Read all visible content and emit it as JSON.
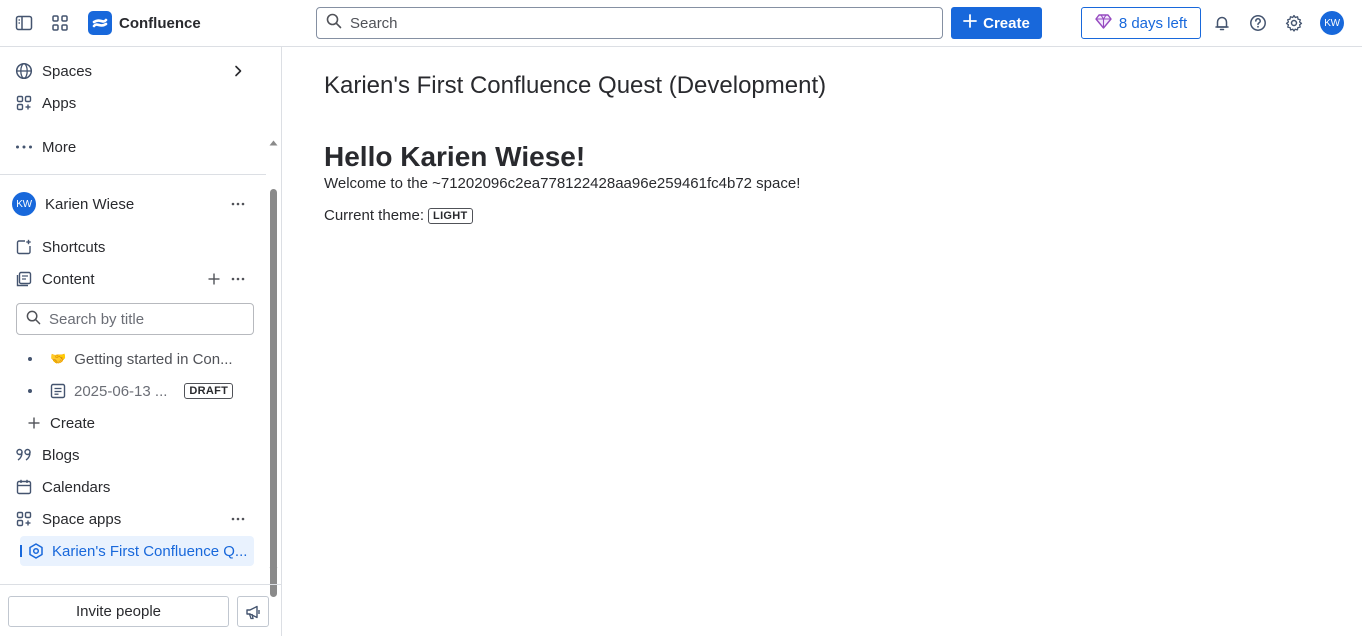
{
  "topbar": {
    "app_name": "Confluence",
    "search_placeholder": "Search",
    "create_label": "Create",
    "trial_label": "8 days left",
    "user_initials": "KW"
  },
  "sidebar": {
    "spaces_label": "Spaces",
    "apps_label": "Apps",
    "more_label": "More",
    "user_name": "Karien Wiese",
    "user_initials": "KW",
    "shortcuts_label": "Shortcuts",
    "content_label": "Content",
    "search_placeholder": "Search by title",
    "tree": [
      {
        "emoji": "🤝",
        "label": "Getting started in Con..."
      },
      {
        "label": "2025-06-13 ...",
        "badge": "DRAFT"
      }
    ],
    "create_label": "Create",
    "blogs_label": "Blogs",
    "calendars_label": "Calendars",
    "space_apps_label": "Space apps",
    "active_space": "Karien's First Confluence Q...",
    "invite_label": "Invite people"
  },
  "main": {
    "space_title": "Karien's First Confluence Quest (Development)",
    "heading": "Hello Karien Wiese!",
    "welcome_text": "Welcome to the ~71202096c2ea778122428aa96e259461fc4b72 space!",
    "theme_label": "Current theme:",
    "theme_value": "LIGHT"
  },
  "colors": {
    "brand": "#1868db",
    "active_bg": "#e9f2fe",
    "text": "#292a2e",
    "border": "#dcdfe4"
  }
}
